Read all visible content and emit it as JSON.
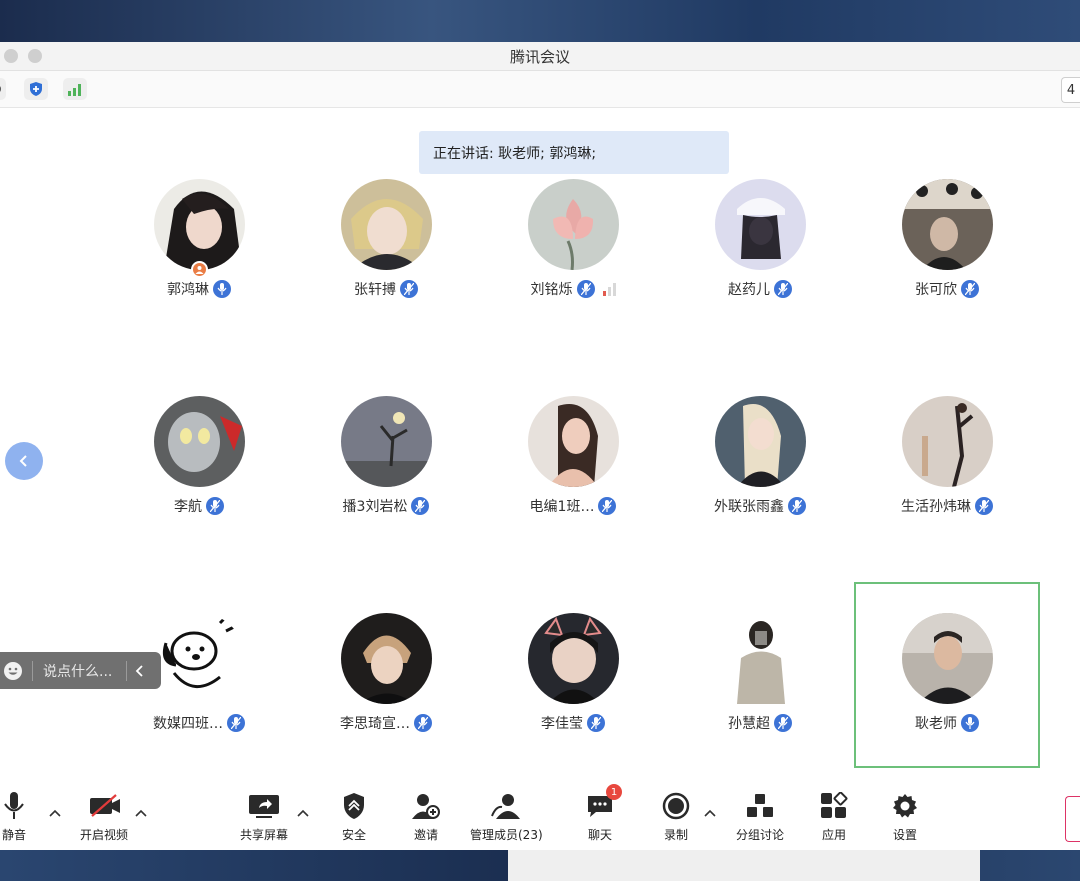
{
  "window": {
    "title": "腾讯会议"
  },
  "statusbar": {
    "right_label": "4"
  },
  "banner": {
    "speaking_text": "正在讲话: 耿老师; 郭鸿琳;"
  },
  "participants": [
    {
      "name": "郭鸿琳"
    },
    {
      "name": "张轩搏"
    },
    {
      "name": "刘铭烁"
    },
    {
      "name": "赵药儿"
    },
    {
      "name": "张可欣"
    },
    {
      "name": "李航"
    },
    {
      "name": "播3刘岩松"
    },
    {
      "name": "电编1班…"
    },
    {
      "name": "外联张雨鑫"
    },
    {
      "name": "生活孙炜琳"
    },
    {
      "name": "数媒四班…"
    },
    {
      "name": "李思琦宣…"
    },
    {
      "name": "李佳莹"
    },
    {
      "name": "孙慧超"
    },
    {
      "name": "耿老师"
    }
  ],
  "chat_input": {
    "placeholder": "说点什么..."
  },
  "toolbar": {
    "mute": "静音",
    "video": "开启视频",
    "share": "共享屏幕",
    "security": "安全",
    "invite": "邀请",
    "members": "管理成员(23)",
    "chat": "聊天",
    "chat_badge": "1",
    "record": "录制",
    "breakout": "分组讨论",
    "apps": "应用",
    "settings": "设置"
  },
  "colors": {
    "accent": "#3d73d6",
    "active_speaker": "#6cc07a",
    "badge": "#e8483e",
    "host": "#ea7d45"
  }
}
